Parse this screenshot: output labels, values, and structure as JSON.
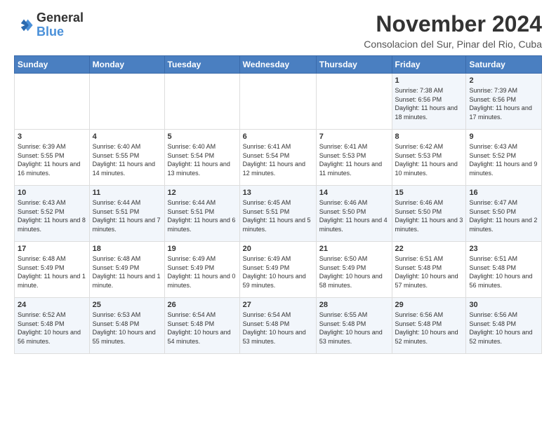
{
  "logo": {
    "line1": "General",
    "line2": "Blue"
  },
  "title": "November 2024",
  "location": "Consolacion del Sur, Pinar del Rio, Cuba",
  "days_of_week": [
    "Sunday",
    "Monday",
    "Tuesday",
    "Wednesday",
    "Thursday",
    "Friday",
    "Saturday"
  ],
  "weeks": [
    [
      {
        "day": "",
        "info": ""
      },
      {
        "day": "",
        "info": ""
      },
      {
        "day": "",
        "info": ""
      },
      {
        "day": "",
        "info": ""
      },
      {
        "day": "",
        "info": ""
      },
      {
        "day": "1",
        "info": "Sunrise: 7:38 AM\nSunset: 6:56 PM\nDaylight: 11 hours and 18 minutes."
      },
      {
        "day": "2",
        "info": "Sunrise: 7:39 AM\nSunset: 6:56 PM\nDaylight: 11 hours and 17 minutes."
      }
    ],
    [
      {
        "day": "3",
        "info": "Sunrise: 6:39 AM\nSunset: 5:55 PM\nDaylight: 11 hours and 16 minutes."
      },
      {
        "day": "4",
        "info": "Sunrise: 6:40 AM\nSunset: 5:55 PM\nDaylight: 11 hours and 14 minutes."
      },
      {
        "day": "5",
        "info": "Sunrise: 6:40 AM\nSunset: 5:54 PM\nDaylight: 11 hours and 13 minutes."
      },
      {
        "day": "6",
        "info": "Sunrise: 6:41 AM\nSunset: 5:54 PM\nDaylight: 11 hours and 12 minutes."
      },
      {
        "day": "7",
        "info": "Sunrise: 6:41 AM\nSunset: 5:53 PM\nDaylight: 11 hours and 11 minutes."
      },
      {
        "day": "8",
        "info": "Sunrise: 6:42 AM\nSunset: 5:53 PM\nDaylight: 11 hours and 10 minutes."
      },
      {
        "day": "9",
        "info": "Sunrise: 6:43 AM\nSunset: 5:52 PM\nDaylight: 11 hours and 9 minutes."
      }
    ],
    [
      {
        "day": "10",
        "info": "Sunrise: 6:43 AM\nSunset: 5:52 PM\nDaylight: 11 hours and 8 minutes."
      },
      {
        "day": "11",
        "info": "Sunrise: 6:44 AM\nSunset: 5:51 PM\nDaylight: 11 hours and 7 minutes."
      },
      {
        "day": "12",
        "info": "Sunrise: 6:44 AM\nSunset: 5:51 PM\nDaylight: 11 hours and 6 minutes."
      },
      {
        "day": "13",
        "info": "Sunrise: 6:45 AM\nSunset: 5:51 PM\nDaylight: 11 hours and 5 minutes."
      },
      {
        "day": "14",
        "info": "Sunrise: 6:46 AM\nSunset: 5:50 PM\nDaylight: 11 hours and 4 minutes."
      },
      {
        "day": "15",
        "info": "Sunrise: 6:46 AM\nSunset: 5:50 PM\nDaylight: 11 hours and 3 minutes."
      },
      {
        "day": "16",
        "info": "Sunrise: 6:47 AM\nSunset: 5:50 PM\nDaylight: 11 hours and 2 minutes."
      }
    ],
    [
      {
        "day": "17",
        "info": "Sunrise: 6:48 AM\nSunset: 5:49 PM\nDaylight: 11 hours and 1 minute."
      },
      {
        "day": "18",
        "info": "Sunrise: 6:48 AM\nSunset: 5:49 PM\nDaylight: 11 hours and 1 minute."
      },
      {
        "day": "19",
        "info": "Sunrise: 6:49 AM\nSunset: 5:49 PM\nDaylight: 11 hours and 0 minutes."
      },
      {
        "day": "20",
        "info": "Sunrise: 6:49 AM\nSunset: 5:49 PM\nDaylight: 10 hours and 59 minutes."
      },
      {
        "day": "21",
        "info": "Sunrise: 6:50 AM\nSunset: 5:49 PM\nDaylight: 10 hours and 58 minutes."
      },
      {
        "day": "22",
        "info": "Sunrise: 6:51 AM\nSunset: 5:48 PM\nDaylight: 10 hours and 57 minutes."
      },
      {
        "day": "23",
        "info": "Sunrise: 6:51 AM\nSunset: 5:48 PM\nDaylight: 10 hours and 56 minutes."
      }
    ],
    [
      {
        "day": "24",
        "info": "Sunrise: 6:52 AM\nSunset: 5:48 PM\nDaylight: 10 hours and 56 minutes."
      },
      {
        "day": "25",
        "info": "Sunrise: 6:53 AM\nSunset: 5:48 PM\nDaylight: 10 hours and 55 minutes."
      },
      {
        "day": "26",
        "info": "Sunrise: 6:54 AM\nSunset: 5:48 PM\nDaylight: 10 hours and 54 minutes."
      },
      {
        "day": "27",
        "info": "Sunrise: 6:54 AM\nSunset: 5:48 PM\nDaylight: 10 hours and 53 minutes."
      },
      {
        "day": "28",
        "info": "Sunrise: 6:55 AM\nSunset: 5:48 PM\nDaylight: 10 hours and 53 minutes."
      },
      {
        "day": "29",
        "info": "Sunrise: 6:56 AM\nSunset: 5:48 PM\nDaylight: 10 hours and 52 minutes."
      },
      {
        "day": "30",
        "info": "Sunrise: 6:56 AM\nSunset: 5:48 PM\nDaylight: 10 hours and 52 minutes."
      }
    ]
  ]
}
